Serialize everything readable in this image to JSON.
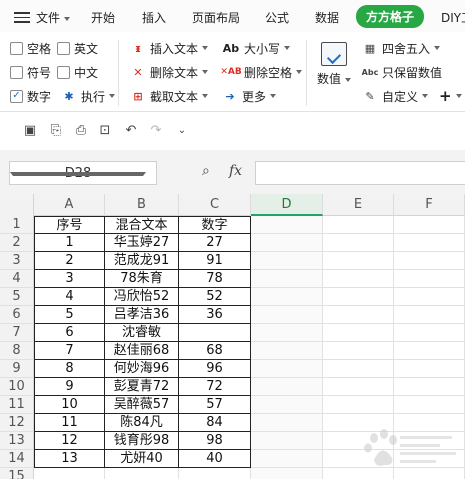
{
  "menubar": {
    "file_label": "文件",
    "items": [
      "开始",
      "插入",
      "页面布局",
      "公式",
      "数据"
    ],
    "active_tab": "方方格子",
    "overflow_tab": "DIY工"
  },
  "ribbon": {
    "checkboxes": [
      {
        "label": "空格",
        "checked": false
      },
      {
        "label": "英文",
        "checked": false
      },
      {
        "label": "符号",
        "checked": false
      },
      {
        "label": "中文",
        "checked": false
      },
      {
        "label": "数字",
        "checked": true
      }
    ],
    "execute_label": "执行",
    "insert_text": "插入文本",
    "delete_text": "删除文本",
    "extract_text": "截取文本",
    "case_label": "大小写",
    "delete_space": "删除空格",
    "more_label": "更多",
    "value_label": "数值",
    "round_label": "四舍五入",
    "keep_value_label": "只保留数值",
    "custom_label": "自定义",
    "add_label": "+"
  },
  "namebox": {
    "value": "D28"
  },
  "fx_label": "fx",
  "sheet": {
    "columns": [
      "A",
      "B",
      "C",
      "D",
      "E",
      "F"
    ],
    "selected_column": "D",
    "rows": [
      {
        "n": "1",
        "a": "序号",
        "b": "混合文本",
        "c": "数字"
      },
      {
        "n": "2",
        "a": "1",
        "b": "华玉婷27",
        "c": "27"
      },
      {
        "n": "3",
        "a": "2",
        "b": "范成龙91",
        "c": "91"
      },
      {
        "n": "4",
        "a": "3",
        "b": "78朱育",
        "c": "78"
      },
      {
        "n": "5",
        "a": "4",
        "b": "冯欣怡52",
        "c": "52"
      },
      {
        "n": "6",
        "a": "5",
        "b": "吕孝洁36",
        "c": "36"
      },
      {
        "n": "7",
        "a": "6",
        "b": "沈睿敏",
        "c": ""
      },
      {
        "n": "8",
        "a": "7",
        "b": "赵佳丽68",
        "c": "68"
      },
      {
        "n": "9",
        "a": "8",
        "b": "何妙海96",
        "c": "96"
      },
      {
        "n": "10",
        "a": "9",
        "b": "彭夏青72",
        "c": "72"
      },
      {
        "n": "11",
        "a": "10",
        "b": "吴醉薇57",
        "c": "57"
      },
      {
        "n": "12",
        "a": "11",
        "b": "陈84凡",
        "c": "84"
      },
      {
        "n": "13",
        "a": "12",
        "b": "钱育彤98",
        "c": "98"
      },
      {
        "n": "14",
        "a": "13",
        "b": "尤妍40",
        "c": "40"
      },
      {
        "n": "15",
        "a": "",
        "b": "",
        "c": ""
      }
    ]
  },
  "colors": {
    "accent_green": "#28a745",
    "sheet_select": "#21a366"
  }
}
